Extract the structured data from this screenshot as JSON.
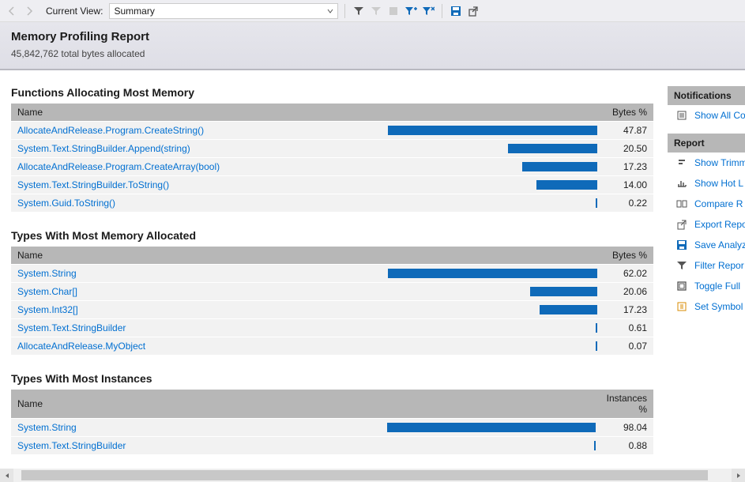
{
  "toolbar": {
    "current_view_label": "Current View:",
    "current_view_value": "Summary"
  },
  "header": {
    "title": "Memory Profiling Report",
    "subtitle": "45,842,762 total bytes allocated"
  },
  "sections": {
    "functions": {
      "title": "Functions Allocating Most Memory",
      "col_name": "Name",
      "col_val": "Bytes %",
      "rows": [
        {
          "name": "AllocateAndRelease.Program.CreateString()",
          "pct": 47.87
        },
        {
          "name": "System.Text.StringBuilder.Append(string)",
          "pct": 20.5
        },
        {
          "name": "AllocateAndRelease.Program.CreateArray(bool)",
          "pct": 17.23
        },
        {
          "name": "System.Text.StringBuilder.ToString()",
          "pct": 14.0
        },
        {
          "name": "System.Guid.ToString()",
          "pct": 0.22
        }
      ]
    },
    "types_mem": {
      "title": "Types With Most Memory Allocated",
      "col_name": "Name",
      "col_val": "Bytes %",
      "rows": [
        {
          "name": "System.String",
          "pct": 62.02
        },
        {
          "name": "System.Char[]",
          "pct": 20.06
        },
        {
          "name": "System.Int32[]",
          "pct": 17.23
        },
        {
          "name": "System.Text.StringBuilder",
          "pct": 0.61
        },
        {
          "name": "AllocateAndRelease.MyObject",
          "pct": 0.07
        }
      ]
    },
    "types_inst": {
      "title": "Types With Most Instances",
      "col_name": "Name",
      "col_val": "Instances %",
      "rows": [
        {
          "name": "System.String",
          "pct": 98.04
        },
        {
          "name": "System.Text.StringBuilder",
          "pct": 0.88
        }
      ]
    }
  },
  "side": {
    "notifications": {
      "title": "Notifications",
      "show_all": "Show All Co"
    },
    "report": {
      "title": "Report",
      "items": [
        {
          "icon": "trim-icon",
          "label": "Show Trimm"
        },
        {
          "icon": "hot-icon",
          "label": "Show Hot L"
        },
        {
          "icon": "compare-icon",
          "label": "Compare R"
        },
        {
          "icon": "export-icon",
          "label": "Export Repo"
        },
        {
          "icon": "save-icon",
          "label": "Save Analyz"
        },
        {
          "icon": "filter-icon",
          "label": "Filter Repor"
        },
        {
          "icon": "fullscreen-icon",
          "label": "Toggle Full"
        },
        {
          "icon": "symbol-icon",
          "label": "Set Symbol"
        }
      ]
    }
  },
  "chart_data": [
    {
      "type": "bar",
      "title": "Functions Allocating Most Memory",
      "xlabel": "",
      "ylabel": "Bytes %",
      "ylim": [
        0,
        100
      ],
      "categories": [
        "AllocateAndRelease.Program.CreateString()",
        "System.Text.StringBuilder.Append(string)",
        "AllocateAndRelease.Program.CreateArray(bool)",
        "System.Text.StringBuilder.ToString()",
        "System.Guid.ToString()"
      ],
      "values": [
        47.87,
        20.5,
        17.23,
        14.0,
        0.22
      ]
    },
    {
      "type": "bar",
      "title": "Types With Most Memory Allocated",
      "xlabel": "",
      "ylabel": "Bytes %",
      "ylim": [
        0,
        100
      ],
      "categories": [
        "System.String",
        "System.Char[]",
        "System.Int32[]",
        "System.Text.StringBuilder",
        "AllocateAndRelease.MyObject"
      ],
      "values": [
        62.02,
        20.06,
        17.23,
        0.61,
        0.07
      ]
    },
    {
      "type": "bar",
      "title": "Types With Most Instances",
      "xlabel": "",
      "ylabel": "Instances %",
      "ylim": [
        0,
        100
      ],
      "categories": [
        "System.String",
        "System.Text.StringBuilder"
      ],
      "values": [
        98.04,
        0.88
      ]
    }
  ]
}
